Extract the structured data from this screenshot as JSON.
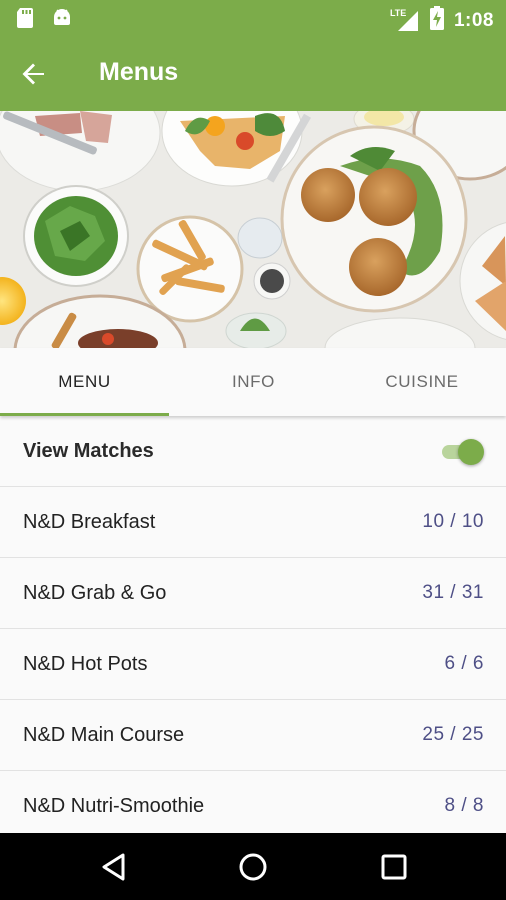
{
  "status_bar": {
    "time": "1:08",
    "network": "LTE",
    "icons": [
      "sd-card-icon",
      "android-icon",
      "lte-signal-icon",
      "battery-charging-icon"
    ]
  },
  "app_bar": {
    "title": "Menus",
    "back_icon": "arrow-left-icon",
    "color": "#7cac4a"
  },
  "tabs": [
    {
      "label": "MENU",
      "active": true
    },
    {
      "label": "INFO",
      "active": false
    },
    {
      "label": "CUISINE",
      "active": false
    }
  ],
  "view_matches": {
    "label": "View Matches",
    "enabled": true
  },
  "menus": [
    {
      "name": "N&D Breakfast",
      "count": "10 / 10"
    },
    {
      "name": "N&D Grab & Go",
      "count": "31 / 31"
    },
    {
      "name": "N&D Hot Pots",
      "count": "6 / 6"
    },
    {
      "name": "N&D Main Course",
      "count": "25 / 25"
    },
    {
      "name": "N&D Nutri-Smoothie",
      "count": "8 / 8"
    }
  ],
  "nav_bar": {
    "icons": [
      "back-triangle-icon",
      "home-circle-icon",
      "recents-square-icon"
    ]
  },
  "colors": {
    "accent": "#7cac4a",
    "count_text": "#4e4f86"
  }
}
